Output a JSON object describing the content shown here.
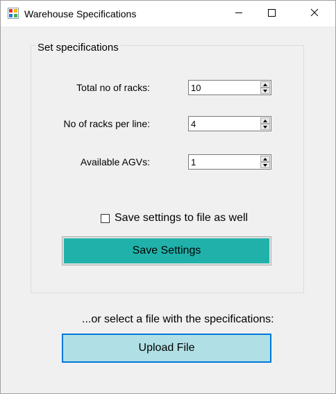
{
  "window": {
    "title": "Warehouse Specifications",
    "app_icon": "winforms-app-icon",
    "controls": [
      "minimize-icon",
      "maximize-icon",
      "close-icon"
    ]
  },
  "group": {
    "title": "Set specifications",
    "fields": [
      {
        "label": "Total no of racks:",
        "value": "10"
      },
      {
        "label": "No of racks per line:",
        "value": "4"
      },
      {
        "label": "Available AGVs:",
        "value": "1"
      }
    ],
    "save_to_file": {
      "label": "Save settings to file as well",
      "checked": false
    },
    "save_button": {
      "label": "Save Settings",
      "color": "#20b2aa"
    }
  },
  "file": {
    "prompt": "...or select a file with the specifications:",
    "upload_button": {
      "label": "Upload File",
      "color": "#b0e0e6",
      "border_color": "#0078d7"
    }
  }
}
